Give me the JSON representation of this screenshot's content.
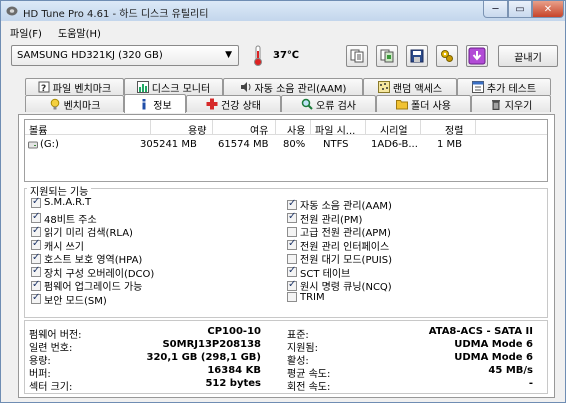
{
  "window": {
    "title": "HD Tune Pro 4.61 - 하드 디스크 유틸리티",
    "min_symbol": "─",
    "max_symbol": "▭",
    "close_symbol": "✕"
  },
  "menu": [
    "파일(F)",
    "도움말(H)"
  ],
  "toolbar": {
    "drive": "SAMSUNG HD321KJ (320 GB)",
    "temperature": "37℃",
    "exit_label": "끝내기",
    "buttons": [
      "copy-text-icon",
      "copy-screenshot-icon",
      "save-icon",
      "options-icon",
      "download-icon"
    ]
  },
  "tabs_row1": [
    "파일 벤치마크",
    "디스크 모니터",
    "자동 소음 관리(AAM)",
    "랜덤 액세스",
    "추가 테스트"
  ],
  "tabs_row2": [
    "벤치마크",
    "정보",
    "건강 상태",
    "오류 검사",
    "폴더 사용",
    "지우기"
  ],
  "active_tab": "정보",
  "volumes": {
    "headers": [
      "볼륨",
      "용량",
      "여유",
      "사용",
      "파일 시...",
      "시리얼",
      "정렬"
    ],
    "rows": [
      [
        "(G:)",
        "305241 MB",
        "61574 MB",
        "80%",
        "NTFS",
        "1AD6-B...",
        "1 MB"
      ]
    ]
  },
  "features": {
    "title": "지원되는 기능",
    "left": [
      {
        "label": "S.M.A.R.T",
        "checked": true
      },
      {
        "label": "48비트 주소",
        "checked": true
      },
      {
        "label": "읽기 미리 검색(RLA)",
        "checked": true
      },
      {
        "label": "캐시 쓰기",
        "checked": true
      },
      {
        "label": "호스트 보호 영역(HPA)",
        "checked": true
      },
      {
        "label": "장치 구성 오버레이(DCO)",
        "checked": true
      },
      {
        "label": "펌웨어 업그레이드 가능",
        "checked": true
      },
      {
        "label": "보안 모드(SM)",
        "checked": true
      }
    ],
    "right": [
      {
        "label": "자동 소음 관리(AAM)",
        "checked": true
      },
      {
        "label": "전원 관리(PM)",
        "checked": true
      },
      {
        "label": "고급 전원 관리(APM)",
        "checked": false
      },
      {
        "label": "전원 관리 인터페이스",
        "checked": true
      },
      {
        "label": "전원 대기 모드(PUIS)",
        "checked": false
      },
      {
        "label": "SCT 테이브",
        "checked": true
      },
      {
        "label": "원시 명령 큐닝(NCQ)",
        "checked": true
      },
      {
        "label": "TRIM",
        "checked": false
      }
    ]
  },
  "info": {
    "left": [
      {
        "label": "펌웨어 버전:",
        "value": "CP100-10"
      },
      {
        "label": "일련 번호:",
        "value": "S0MRJ13P208138"
      },
      {
        "label": "용량:",
        "value": "320,1 GB (298,1 GB)"
      },
      {
        "label": "버퍼:",
        "value": "16384 KB"
      },
      {
        "label": "섹터 크기:",
        "value": "512 bytes"
      }
    ],
    "right": [
      {
        "label": "표준:",
        "value": "ATA8-ACS - SATA II"
      },
      {
        "label": "지원됨:",
        "value": "UDMA Mode 6"
      },
      {
        "label": "활성:",
        "value": "UDMA Mode 6"
      },
      {
        "label": "평균 속도:",
        "value": "45 MB/s"
      },
      {
        "label": "회전 속도:",
        "value": "-"
      }
    ]
  }
}
